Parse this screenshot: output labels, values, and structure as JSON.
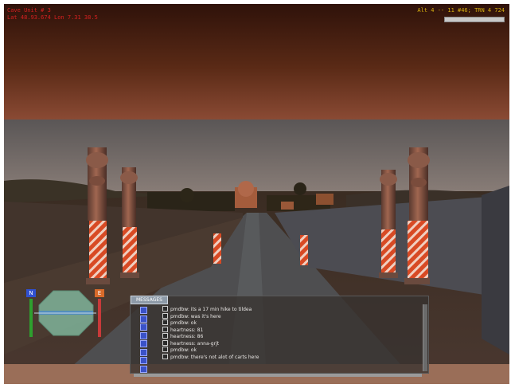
{
  "hud": {
    "top_left": [
      "Cave Unit # 3",
      "Lat 48.93.674 Lon  7.31 38.5"
    ],
    "top_right": "Alt 4  -- 11 #46; TRN 4  724"
  },
  "compass": {
    "left_marker": "N",
    "right_marker": "E"
  },
  "chat": {
    "tab_label": "MESSAGES",
    "lines": [
      "pmdbw: its a 17 min hike to tildea",
      "pmdbw: was it's here",
      "pmdbw: ok",
      "heartness: 81",
      "heartness: 86",
      "heartness: anna-grjt",
      "pmdbw: ok",
      "pmdbw: there's not alot of carts here"
    ]
  },
  "colors": {
    "sky_top": "#4a2312",
    "sky_bottom": "#8a4a30",
    "barrier_red": "#e0502a",
    "barrier_white": "#f2d2c4"
  }
}
